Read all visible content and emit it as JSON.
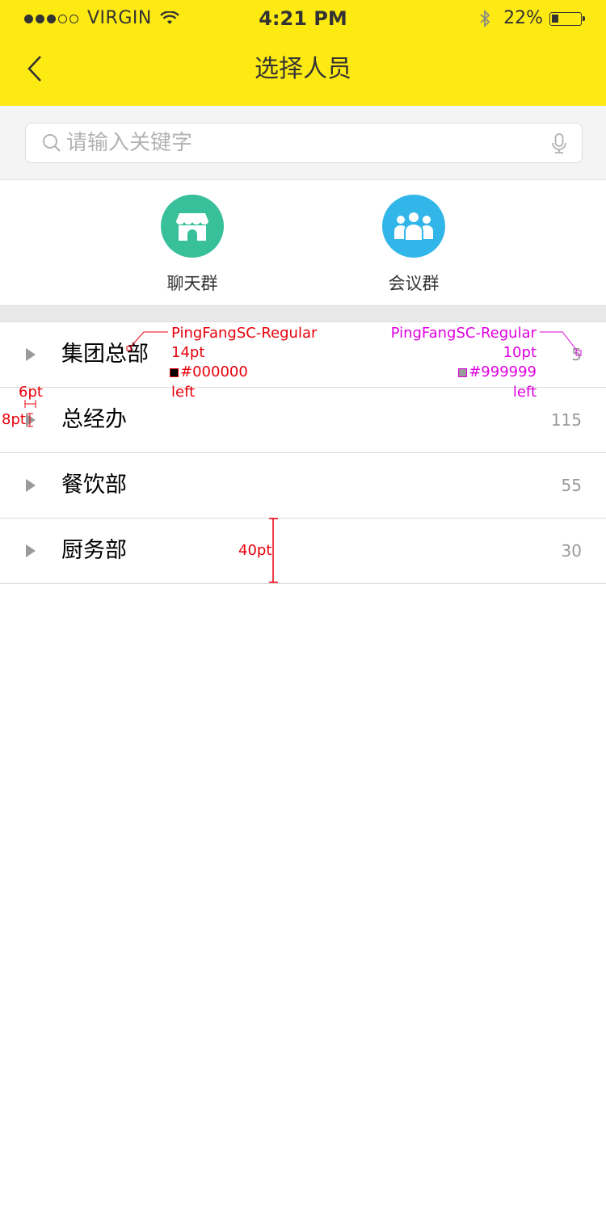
{
  "status_bar": {
    "carrier": "VIRGIN",
    "time": "4:21 PM",
    "battery": "22%",
    "battery_level": 0.22
  },
  "nav": {
    "title": "选择人员",
    "back_icon": "chevron-left-icon"
  },
  "search": {
    "placeholder": "请输入关键字",
    "search_icon": "search-icon",
    "mic_icon": "microphone-icon"
  },
  "groups": [
    {
      "label": "聊天群",
      "icon": "store-icon",
      "color": "#38C09A"
    },
    {
      "label": "会议群",
      "icon": "people-icon",
      "color": "#32B6E9"
    }
  ],
  "departments": [
    {
      "name": "集团总部",
      "count": "5"
    },
    {
      "name": "总经办",
      "count": "115"
    },
    {
      "name": "餐饮部",
      "count": "55"
    },
    {
      "name": "厨务部",
      "count": "30"
    }
  ],
  "annotations": {
    "name_spec": {
      "font": "PingFangSC-Regular",
      "size": "14pt",
      "color": "#000000",
      "align": "left"
    },
    "count_spec": {
      "font": "PingFangSC-Regular",
      "size": "10pt",
      "color": "#999999",
      "align": "left"
    },
    "triangle_width": "6pt",
    "triangle_height": "8pt",
    "row_height": "40pt"
  },
  "colors": {
    "nav_bg": "#FEEA13",
    "search_bg": "#F4F4F4",
    "divider": "#E9E9E9"
  }
}
